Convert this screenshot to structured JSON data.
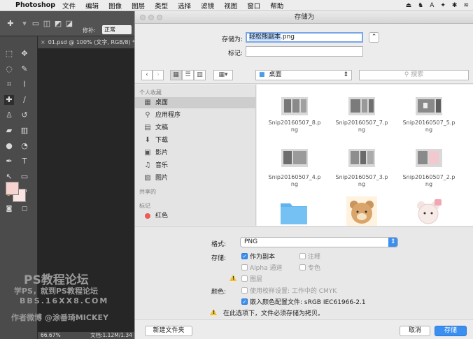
{
  "menubar": {
    "apple_glyph": "",
    "app_name": "Photoshop",
    "items": [
      "文件",
      "编辑",
      "图像",
      "图层",
      "类型",
      "选择",
      "滤镜",
      "视图",
      "窗口",
      "帮助"
    ],
    "status_icons": [
      "⏏",
      "♞",
      "A",
      "✦",
      "✱",
      "≋"
    ]
  },
  "photoshop": {
    "feather_label": "修补:",
    "mode_value": "正常",
    "doc_tab": "01.psd @ 100% (文字, RGB/8) *",
    "zoom": "66.67%",
    "doc_size": "文档:1.12M/1.34"
  },
  "watermark": {
    "line1": "PS教程论坛",
    "line2": "学PS，就到PS教程论坛",
    "line3": "BBS.16XX8.COM",
    "line4": "作者微博 @涂番琦MICKEY"
  },
  "dialog": {
    "title": "存储为",
    "save_as_label": "存储为:",
    "filename_selected": "轻松熊副本",
    "filename_ext": ".png",
    "tags_label": "标记:",
    "location": "桌面",
    "search_placeholder": "搜索",
    "sidebar": {
      "favorites_header": "个人收藏",
      "favorites": [
        {
          "icon": "desktop-icon",
          "glyph": "▦",
          "label": "桌面"
        },
        {
          "icon": "applications-icon",
          "glyph": "⚲",
          "label": "应用程序"
        },
        {
          "icon": "documents-icon",
          "glyph": "▤",
          "label": "文稿"
        },
        {
          "icon": "downloads-icon",
          "glyph": "⬇",
          "label": "下载"
        },
        {
          "icon": "movies-icon",
          "glyph": "▣",
          "label": "影片"
        },
        {
          "icon": "music-icon",
          "glyph": "♫",
          "label": "音乐"
        },
        {
          "icon": "pictures-icon",
          "glyph": "▨",
          "label": "图片"
        }
      ],
      "shared_header": "共享的",
      "tags_header": "标记",
      "tags": [
        {
          "label": "红色",
          "color": "#ed5a57"
        }
      ]
    },
    "files": [
      {
        "line1": "Snip20160507_8.p",
        "line2": "ng"
      },
      {
        "line1": "Snip20160507_7.p",
        "line2": "ng"
      },
      {
        "line1": "Snip20160507_5.p",
        "line2": "ng"
      },
      {
        "line1": "Snip20160507_4.p",
        "line2": "ng"
      },
      {
        "line1": "Snip20160507_3.p",
        "line2": "ng"
      },
      {
        "line1": "Snip20160507_2.p",
        "line2": "ng"
      }
    ],
    "format_label": "格式:",
    "format_value": "PNG",
    "save_label": "存储:",
    "options": {
      "as_copy": "作为副本",
      "notes": "注释",
      "alpha": "Alpha 通道",
      "spot": "专色",
      "layers": "图层"
    },
    "color_label": "颜色:",
    "proof_setup": "使用校样设置: 工作中的 CMYK",
    "embed_profile": "嵌入颜色配置文件: sRGB IEC61966-2.1",
    "copy_warning": "在此选项下，文件必须存储为拷贝。",
    "new_folder": "新建文件夹",
    "cancel": "取消",
    "save": "存储"
  }
}
